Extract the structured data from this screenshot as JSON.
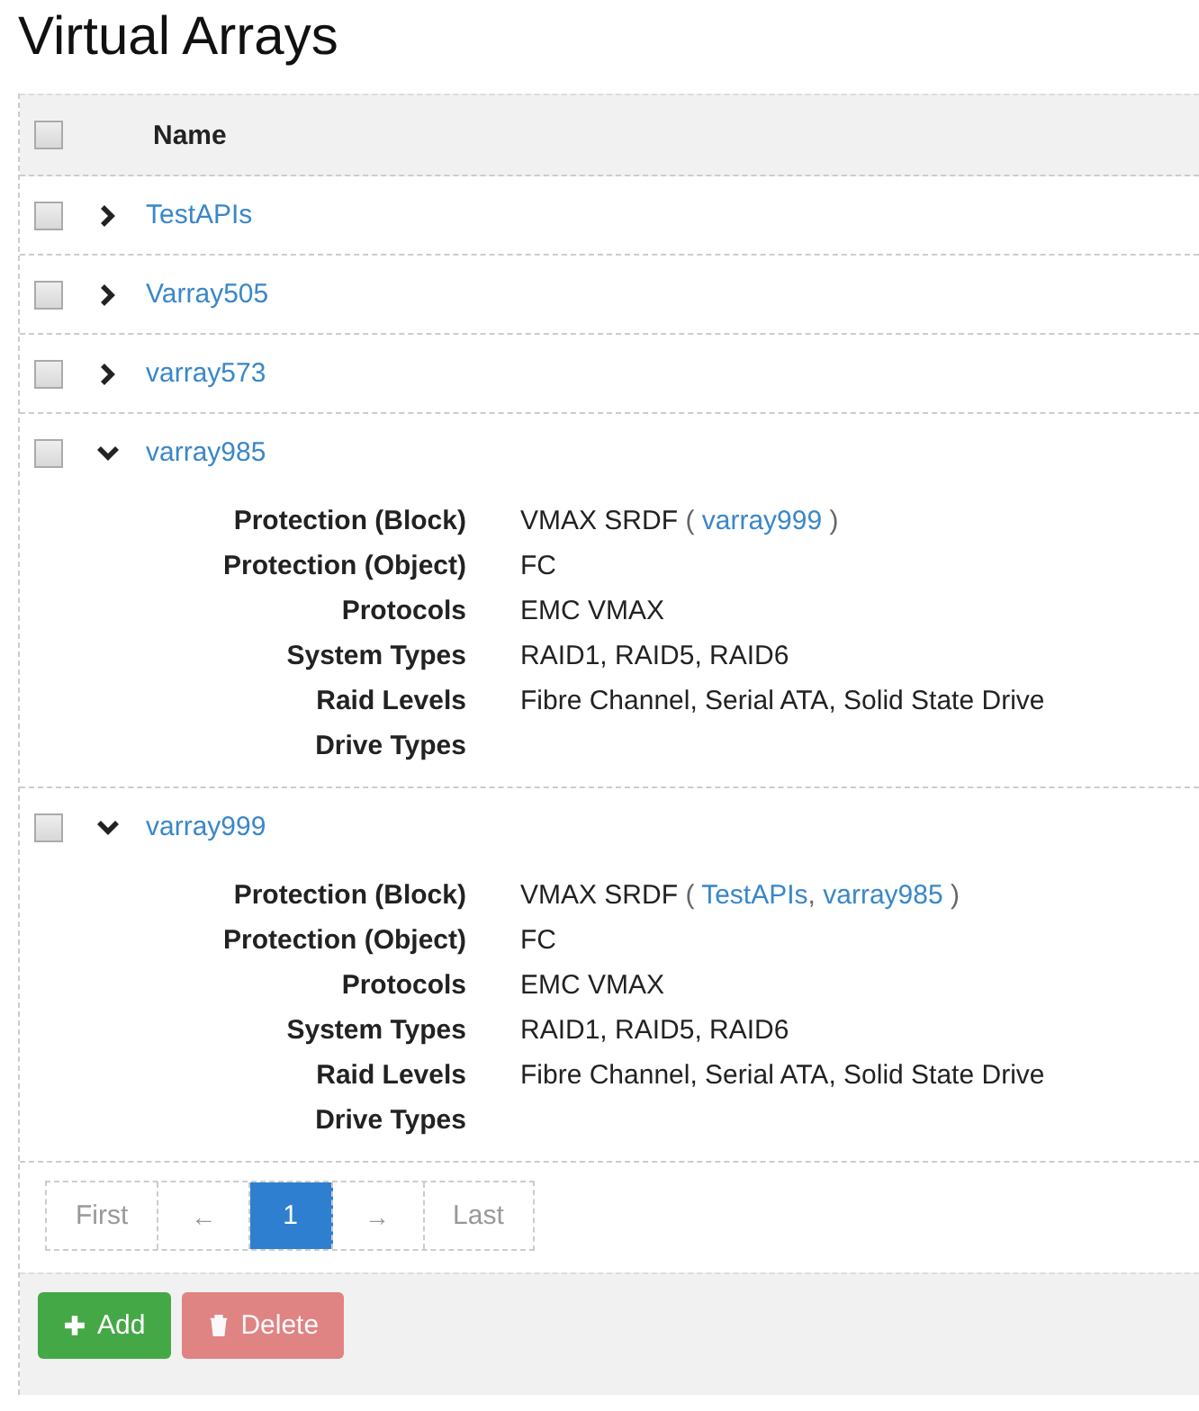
{
  "title": "Virtual Arrays",
  "table": {
    "header": {
      "checked": false,
      "column": "Name"
    },
    "rows": [
      {
        "name": "TestAPIs",
        "checked": false,
        "expanded": false
      },
      {
        "name": "Varray505",
        "checked": false,
        "expanded": false
      },
      {
        "name": "varray573",
        "checked": false,
        "expanded": false
      },
      {
        "name": "varray985",
        "checked": false,
        "expanded": true,
        "details": [
          {
            "label": "Protection (Block)",
            "value": [
              {
                "kind": "text",
                "text": "VMAX SRDF "
              },
              {
                "kind": "muted",
                "text": "( "
              },
              {
                "kind": "link",
                "text": "varray999"
              },
              {
                "kind": "muted",
                "text": " )"
              }
            ]
          },
          {
            "label": "Protection (Object)",
            "value": [
              {
                "kind": "text",
                "text": "FC"
              }
            ]
          },
          {
            "label": "Protocols",
            "value": [
              {
                "kind": "text",
                "text": "EMC VMAX"
              }
            ]
          },
          {
            "label": "System Types",
            "value": [
              {
                "kind": "text",
                "text": "RAID1, RAID5, RAID6"
              }
            ]
          },
          {
            "label": "Raid Levels",
            "value": [
              {
                "kind": "text",
                "text": "Fibre Channel, Serial ATA, Solid State Drive"
              }
            ]
          },
          {
            "label": "Drive Types"
          }
        ]
      },
      {
        "name": "varray999",
        "checked": false,
        "expanded": true,
        "details": [
          {
            "label": "Protection (Block)",
            "value": [
              {
                "kind": "text",
                "text": "VMAX SRDF "
              },
              {
                "kind": "muted",
                "text": "( "
              },
              {
                "kind": "link",
                "text": "TestAPIs"
              },
              {
                "kind": "muted",
                "text": ", "
              },
              {
                "kind": "link",
                "text": "varray985"
              },
              {
                "kind": "muted",
                "text": " )"
              }
            ]
          },
          {
            "label": "Protection (Object)",
            "value": [
              {
                "kind": "text",
                "text": "FC"
              }
            ]
          },
          {
            "label": "Protocols",
            "value": [
              {
                "kind": "text",
                "text": "EMC VMAX"
              }
            ]
          },
          {
            "label": "System Types",
            "value": [
              {
                "kind": "text",
                "text": "RAID1, RAID5, RAID6"
              }
            ]
          },
          {
            "label": "Raid Levels",
            "value": [
              {
                "kind": "text",
                "text": "Fibre Channel, Serial ATA, Solid State Drive"
              }
            ]
          },
          {
            "label": "Drive Types"
          }
        ]
      }
    ]
  },
  "pagination": [
    {
      "kind": "first",
      "text": "First",
      "selected": false
    },
    {
      "kind": "prev",
      "text": "←",
      "selected": false
    },
    {
      "kind": "page",
      "text": "1",
      "selected": true
    },
    {
      "kind": "next",
      "text": "→",
      "selected": false
    },
    {
      "kind": "last",
      "text": "Last",
      "selected": false
    }
  ],
  "buttons": [
    {
      "kind": "add",
      "text": "Add",
      "disabled": false
    },
    {
      "kind": "delete",
      "text": "Delete",
      "disabled": true
    }
  ]
}
